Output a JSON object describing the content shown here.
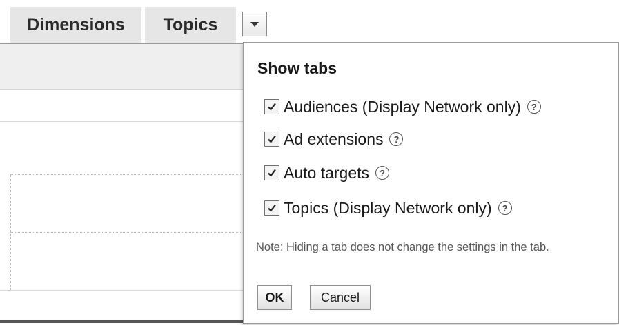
{
  "tabs": {
    "dimensions_label": "Dimensions",
    "topics_label": "Topics"
  },
  "popup": {
    "title": "Show tabs",
    "options": [
      {
        "label": "Audiences (Display Network only)",
        "checked": true
      },
      {
        "label": "Ad extensions",
        "checked": true
      },
      {
        "label": "Auto targets",
        "checked": true
      },
      {
        "label": "Topics (Display Network only)",
        "checked": true
      }
    ],
    "help_glyph": "?",
    "note": "Note: Hiding a tab does not change the settings in the tab.",
    "ok_label": "OK",
    "cancel_label": "Cancel"
  },
  "icons": {
    "dropdown": "chevron-down-icon",
    "checkbox": "checkmark-icon",
    "help": "help-icon"
  }
}
